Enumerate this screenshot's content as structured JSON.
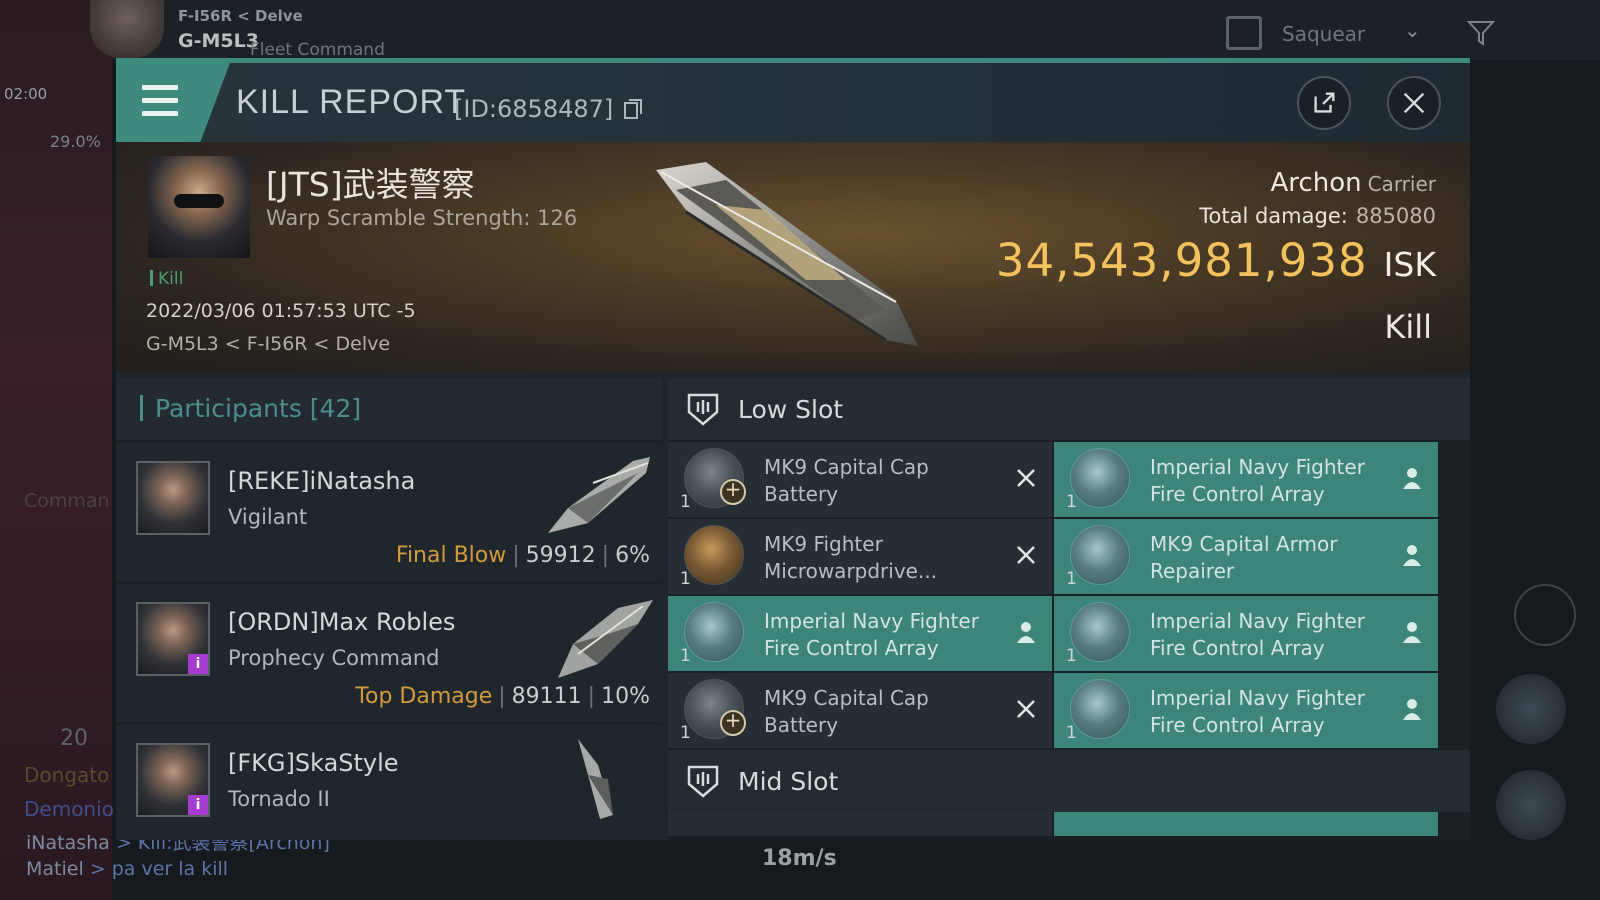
{
  "hud": {
    "location_small": "F-I56R < Delve",
    "location_big": "G-M5L3",
    "fleet_command": "Fleet Command",
    "time": "02:00",
    "percent": "29.0%",
    "select_label": "Saquear",
    "speed": "18m/s",
    "count": "20",
    "command_text": "Comman",
    "chat": [
      {
        "name": "Dongato",
        "text": ""
      },
      {
        "name": "Demonio",
        "text": ""
      },
      {
        "name": "iNatasha",
        "text": " > Kill:武装警察[Archon]"
      },
      {
        "name": "Matiel",
        "text": " > pa ver la kill"
      }
    ]
  },
  "header": {
    "title": "KILL REPORT",
    "id_text": "[ID:6858487]"
  },
  "victim": {
    "name": "[JTS]武装警察",
    "warp_scramble": "Warp Scramble Strength: 126",
    "kill_tag": "Kill",
    "datetime": "2022/03/06 01:57:53 UTC -5",
    "location": "G-M5L3 < F-I56R < Delve"
  },
  "ship": {
    "name": "Archon",
    "class": "Carrier",
    "total_damage_label": "Total damage:",
    "total_damage": "885080",
    "isk_value": "34,543,981,938",
    "isk_unit": "ISK",
    "status": "Kill"
  },
  "participants": {
    "header": "Participants [42]",
    "rows": [
      {
        "name": "[REKE]iNatasha",
        "ship": "Vigilant",
        "tag": "Final Blow",
        "damage": "59912",
        "percent": "6%",
        "badge": false
      },
      {
        "name": "[ORDN]Max Robles",
        "ship": "Prophecy Command",
        "tag": "Top Damage",
        "damage": "89111",
        "percent": "10%",
        "badge": true
      },
      {
        "name": "[FKG]SkaStyle",
        "ship": "Tornado II",
        "tag": "",
        "damage": "",
        "percent": "",
        "badge": true
      }
    ]
  },
  "low_slot": {
    "label": "Low Slot",
    "items": [
      {
        "name": "MK9 Capital Cap Battery",
        "qty": "1",
        "fitted": false,
        "icon": "battery-icon",
        "mark": "destroyed-x-icon"
      },
      {
        "name": "Imperial Navy Fighter Fire Control Array",
        "qty": "1",
        "fitted": true,
        "icon": "fighter-icon",
        "mark": "dropped-person-icon"
      },
      {
        "name": "MK9 Fighter Microwarpdrive...",
        "qty": "1",
        "fitted": false,
        "icon": "microwarpdrive-icon",
        "mark": "destroyed-x-icon"
      },
      {
        "name": "MK9 Capital Armor Repairer",
        "qty": "1",
        "fitted": true,
        "icon": "armor-repairer-icon",
        "mark": "dropped-person-icon"
      },
      {
        "name": "Imperial Navy Fighter Fire Control Array",
        "qty": "1",
        "fitted": true,
        "icon": "fighter-icon",
        "mark": "dropped-person-icon"
      },
      {
        "name": "Imperial Navy Fighter Fire Control Array",
        "qty": "1",
        "fitted": true,
        "icon": "fighter-icon",
        "mark": "dropped-person-icon"
      },
      {
        "name": "MK9 Capital Cap Battery",
        "qty": "1",
        "fitted": false,
        "icon": "battery-icon",
        "mark": "destroyed-x-icon"
      },
      {
        "name": "Imperial Navy Fighter Fire Control Array",
        "qty": "1",
        "fitted": true,
        "icon": "fighter-icon",
        "mark": "dropped-person-icon"
      }
    ]
  },
  "mid_slot": {
    "label": "Mid Slot"
  },
  "colors": {
    "accent_teal": "#3e8a7c",
    "isk_gold": "#f4c25c",
    "tag_orange": "#d39a3d"
  }
}
